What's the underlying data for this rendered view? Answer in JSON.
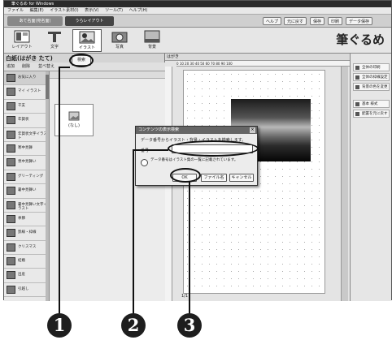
{
  "window": {
    "title": "筆ぐるめ for Windows",
    "menu": [
      "ファイル",
      "編集(E)",
      "イラスト素材(I)",
      "表示(V)",
      "ツール(T)",
      "ヘルプ(H)"
    ]
  },
  "tabs": [
    {
      "label": "あて名面(宛名面)"
    },
    {
      "label": "うらレイアウト"
    }
  ],
  "top_buttons": [
    "ヘルプ",
    "元に戻す",
    "保存",
    "印刷",
    "データ保存"
  ],
  "brand": "筆ぐるめ",
  "ribbon": {
    "tools": [
      {
        "label": "レイアウト",
        "icon": "layout-icon"
      },
      {
        "label": "文字",
        "icon": "text-icon"
      },
      {
        "label": "イラスト",
        "icon": "illustration-icon"
      },
      {
        "label": "写真",
        "icon": "photo-icon"
      },
      {
        "label": "背景",
        "icon": "background-icon"
      }
    ]
  },
  "left_pane": {
    "title": "白紙(はがき たて)",
    "toolbar": [
      "追加",
      "削除",
      "並べ替え"
    ],
    "search_button": "検索",
    "categories": [
      {
        "label": "お気に入り"
      },
      {
        "label": "マイ イラスト"
      },
      {
        "label": "干支"
      },
      {
        "label": "年賀状"
      },
      {
        "label": "年賀状文字イラスト"
      },
      {
        "label": "寒中見舞"
      },
      {
        "label": "喪中見舞い"
      },
      {
        "label": "グリーティング"
      },
      {
        "label": "暑中見舞い"
      },
      {
        "label": "暑中見舞い文字イラスト"
      },
      {
        "label": "季節"
      },
      {
        "label": "罫線・枠線"
      },
      {
        "label": "クリスマス"
      },
      {
        "label": "結婚"
      },
      {
        "label": "出産"
      },
      {
        "label": "引越し"
      }
    ],
    "thumbnail_label": "(なし)"
  },
  "editor": {
    "label": "はがき",
    "ruler": "0  10  20  30  40  50  60  70  80  90  100",
    "page_indicator": "1/1"
  },
  "right_pane": {
    "items": [
      "全体の印刷",
      "全体の枠線設定",
      "背景の色を変更",
      "基本 様式",
      "配置を元に戻す"
    ]
  },
  "dialog": {
    "title": "コンテンツの表示検索",
    "message": "データ番号からイラスト・背景・イラストを検索します。",
    "field_label": "番号",
    "hint": "データ番号はイラスト集の一覧に記載されています。",
    "ok": "OK",
    "other": "ファイル名",
    "cancel": "キャンセル"
  },
  "callouts": [
    "1",
    "2",
    "3"
  ]
}
